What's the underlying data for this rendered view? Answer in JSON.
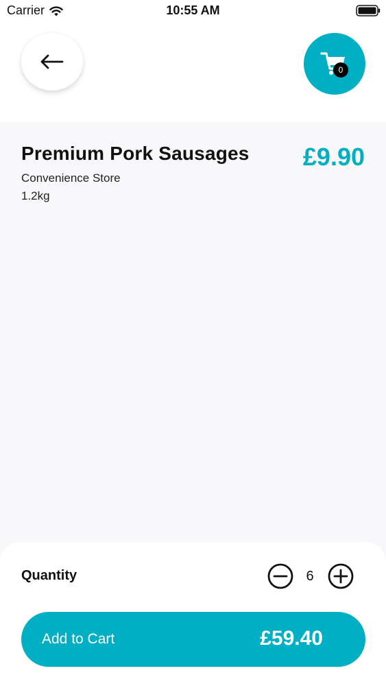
{
  "status_bar": {
    "carrier": "Carrier",
    "time": "10:55 AM"
  },
  "header": {
    "back_icon": "arrow-left-icon",
    "cart_icon": "shopping-cart-icon",
    "cart_count": "0"
  },
  "product": {
    "name": "Premium Pork Sausages",
    "price": "£9.90",
    "store": "Convenience Store",
    "weight": "1.2kg"
  },
  "quantity": {
    "label": "Quantity",
    "value": "6",
    "minus_icon": "minus-circle-icon",
    "plus_icon": "plus-circle-icon"
  },
  "cart_action": {
    "label": "Add to Cart",
    "total": "£59.40"
  },
  "colors": {
    "accent": "#00afc4",
    "panel_bg": "#f8f8fa"
  }
}
